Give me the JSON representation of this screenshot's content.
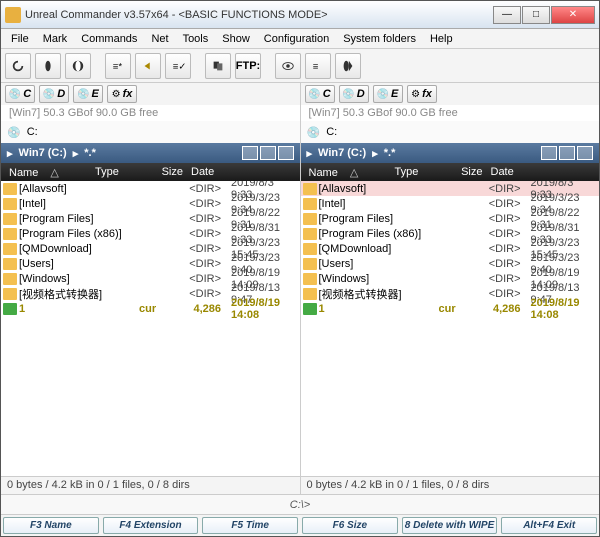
{
  "title": "Unreal Commander v3.57x64 - <BASIC FUNCTIONS MODE>",
  "menu": [
    "File",
    "Mark",
    "Commands",
    "Net",
    "Tools",
    "Show",
    "Configuration",
    "System folders",
    "Help"
  ],
  "ftp_label": "FTP:",
  "drives": {
    "c": "C",
    "d": "D",
    "e": "E",
    "fx": "fx"
  },
  "freespace": "[Win7]  50.3 GBof 90.0 GB free",
  "curdrive_label": "C:",
  "path_label": "Win7 (C:)",
  "path_crumb": "*.*",
  "cols": {
    "name": "Name",
    "type": "Type",
    "size": "Size",
    "date": "Date"
  },
  "rows": [
    {
      "name": "[Allavsoft]",
      "size": "<DIR>",
      "date": "2019/8/3 9:33",
      "sel": true
    },
    {
      "name": "[Intel]",
      "size": "<DIR>",
      "date": "2019/3/23 9:34"
    },
    {
      "name": "[Program Files]",
      "size": "<DIR>",
      "date": "2019/8/22 9:31"
    },
    {
      "name": "[Program Files (x86)]",
      "size": "<DIR>",
      "date": "2019/8/31 9:33"
    },
    {
      "name": "[QMDownload]",
      "size": "<DIR>",
      "date": "2019/3/23 15:45"
    },
    {
      "name": "[Users]",
      "size": "<DIR>",
      "date": "2019/3/23 9:40"
    },
    {
      "name": "[Windows]",
      "size": "<DIR>",
      "date": "2019/8/19 14:09"
    },
    {
      "name": "[视频格式转换器]",
      "size": "<DIR>",
      "date": "2019/8/13 9:47"
    },
    {
      "name": "1",
      "type": "cur",
      "size": "4,286",
      "date": "2019/8/19 14:08",
      "special": true
    }
  ],
  "status": "0 bytes / 4.2 kB in 0 / 1 files, 0 / 8 dirs",
  "cmd_prompt": "C:\\>",
  "fn": {
    "f3": "F3 Name",
    "f4": "F4 Extension",
    "f5": "F5 Time",
    "f6": "F6 Size",
    "f8": "8 Delete with WIPE",
    "altf4": "Alt+F4 Exit"
  }
}
